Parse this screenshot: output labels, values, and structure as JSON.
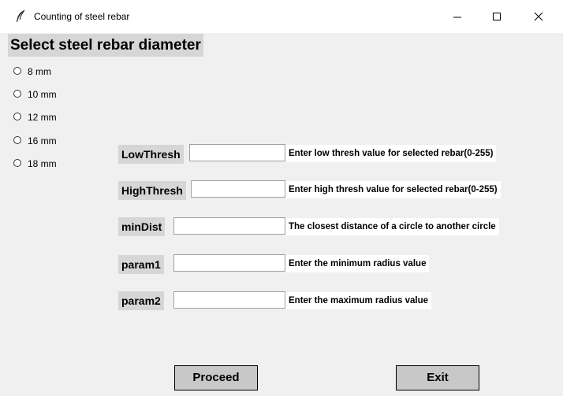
{
  "window": {
    "title": "Counting of steel rebar",
    "icons": [
      "feather-icon",
      "minimize-icon",
      "maximize-icon",
      "close-icon"
    ]
  },
  "heading": "Select steel rebar diameter",
  "diameters": [
    "8 mm",
    "10 mm",
    "12 mm",
    "16 mm",
    "18 mm"
  ],
  "params": [
    {
      "label": "LowThresh",
      "value": "",
      "hint": "Enter low thresh value for selected rebar(0-255)"
    },
    {
      "label": "HighThresh",
      "value": "",
      "hint": "Enter high thresh value for selected rebar(0-255)"
    },
    {
      "label": "minDist",
      "value": "",
      "hint": "The closest distance of a circle to another circle"
    },
    {
      "label": "param1",
      "value": "",
      "hint": "Enter the minimum radius value"
    },
    {
      "label": "param2",
      "value": "",
      "hint": "Enter the maximum radius value"
    }
  ],
  "buttons": {
    "proceed": "Proceed",
    "exit": "Exit"
  }
}
